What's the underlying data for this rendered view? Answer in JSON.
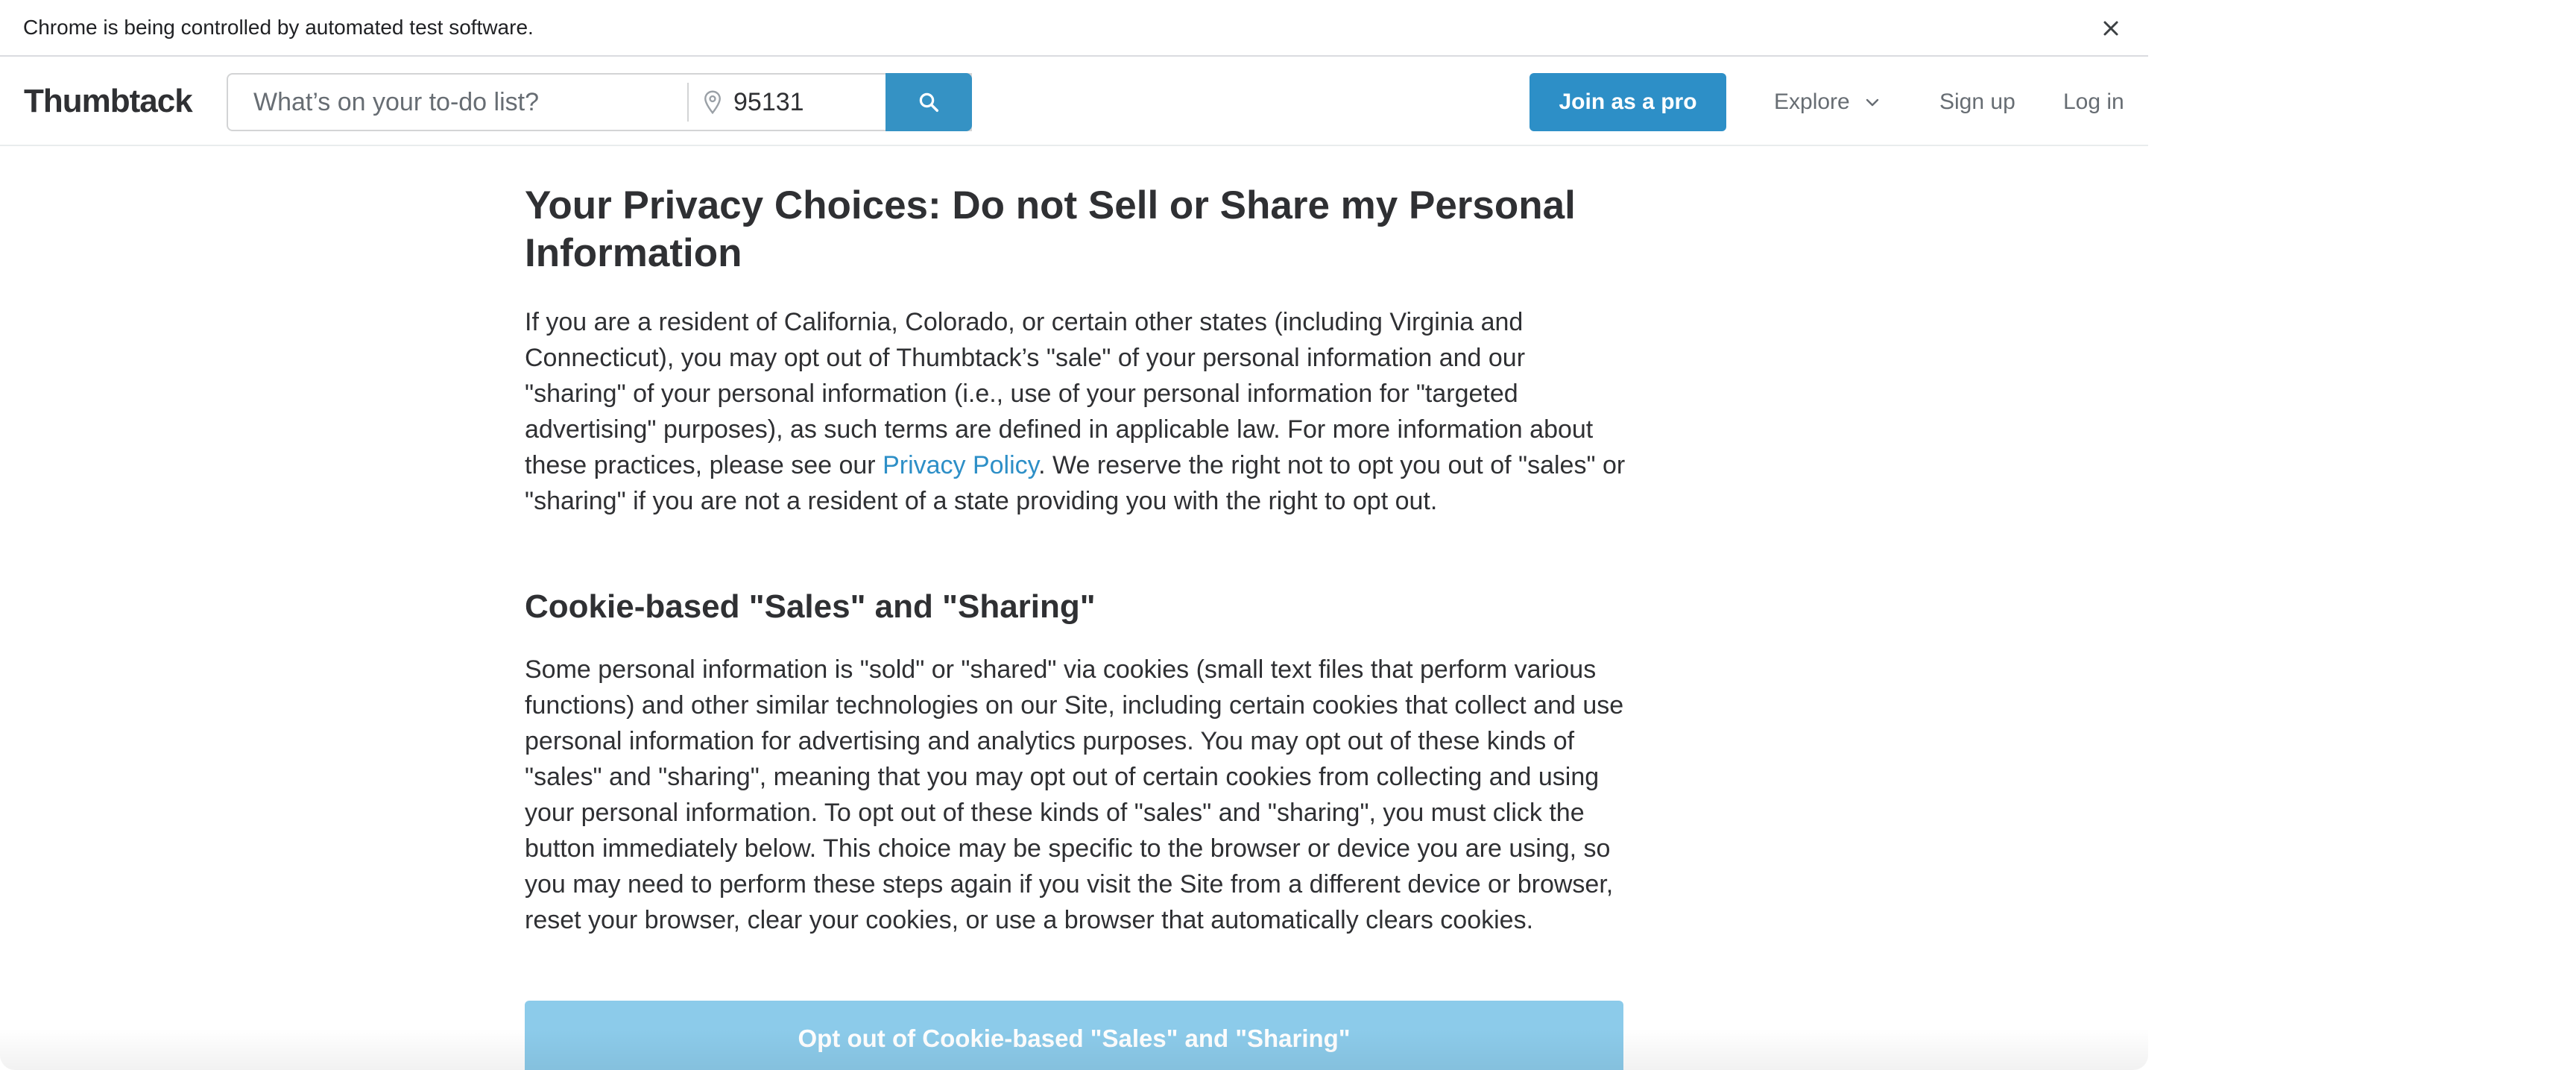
{
  "infobar": {
    "message": "Chrome is being controlled by automated test software.",
    "close_icon": "close-icon"
  },
  "header": {
    "logo": "Thumbtack",
    "search_placeholder": "What’s on your to-do list?",
    "zip_value": "95131",
    "join_label": "Join as a pro",
    "explore_label": "Explore",
    "signup_label": "Sign up",
    "login_label": "Log in",
    "accent_color": "#2d8fc7"
  },
  "main": {
    "title": "Your Privacy Choices: Do not Sell or Share my Personal Information",
    "para1_before_link": "If you are a resident of California, Colorado, or certain other states (including Virginia and Connecticut), you may opt out of Thumbtack’s \"sale\" of your personal information and our \"sharing\" of your personal information (i.e., use of your personal information for \"targeted advertising\" purposes), as such terms are defined in applicable law. For more information about these practices, please see our ",
    "para1_link": "Privacy Policy",
    "para1_after_link": ". We reserve the right not to opt you out of \"sales\" or \"sharing\" if you are not a resident of a state providing you with the right to opt out.",
    "section_title": "Cookie-based \"Sales\" and \"Sharing\"",
    "para2": "Some personal information is \"sold\" or \"shared\" via cookies (small text files that perform various functions) and other similar technologies on our Site, including certain cookies that collect and use personal information for advertising and analytics purposes. You may opt out of these kinds of \"sales\" and \"sharing\", meaning that you may opt out of certain cookies from collecting and using your personal information. To opt out of these kinds of \"sales\" and \"sharing\", you must click the button immediately below. This choice may be specific to the browser or device you are using, so you may need to perform these steps again if you visit the Site from a different device or browser, reset your browser, clear your cookies, or use a browser that automatically clears cookies.",
    "optout_label": "Opt out of Cookie-based \"Sales\" and \"Sharing\""
  }
}
